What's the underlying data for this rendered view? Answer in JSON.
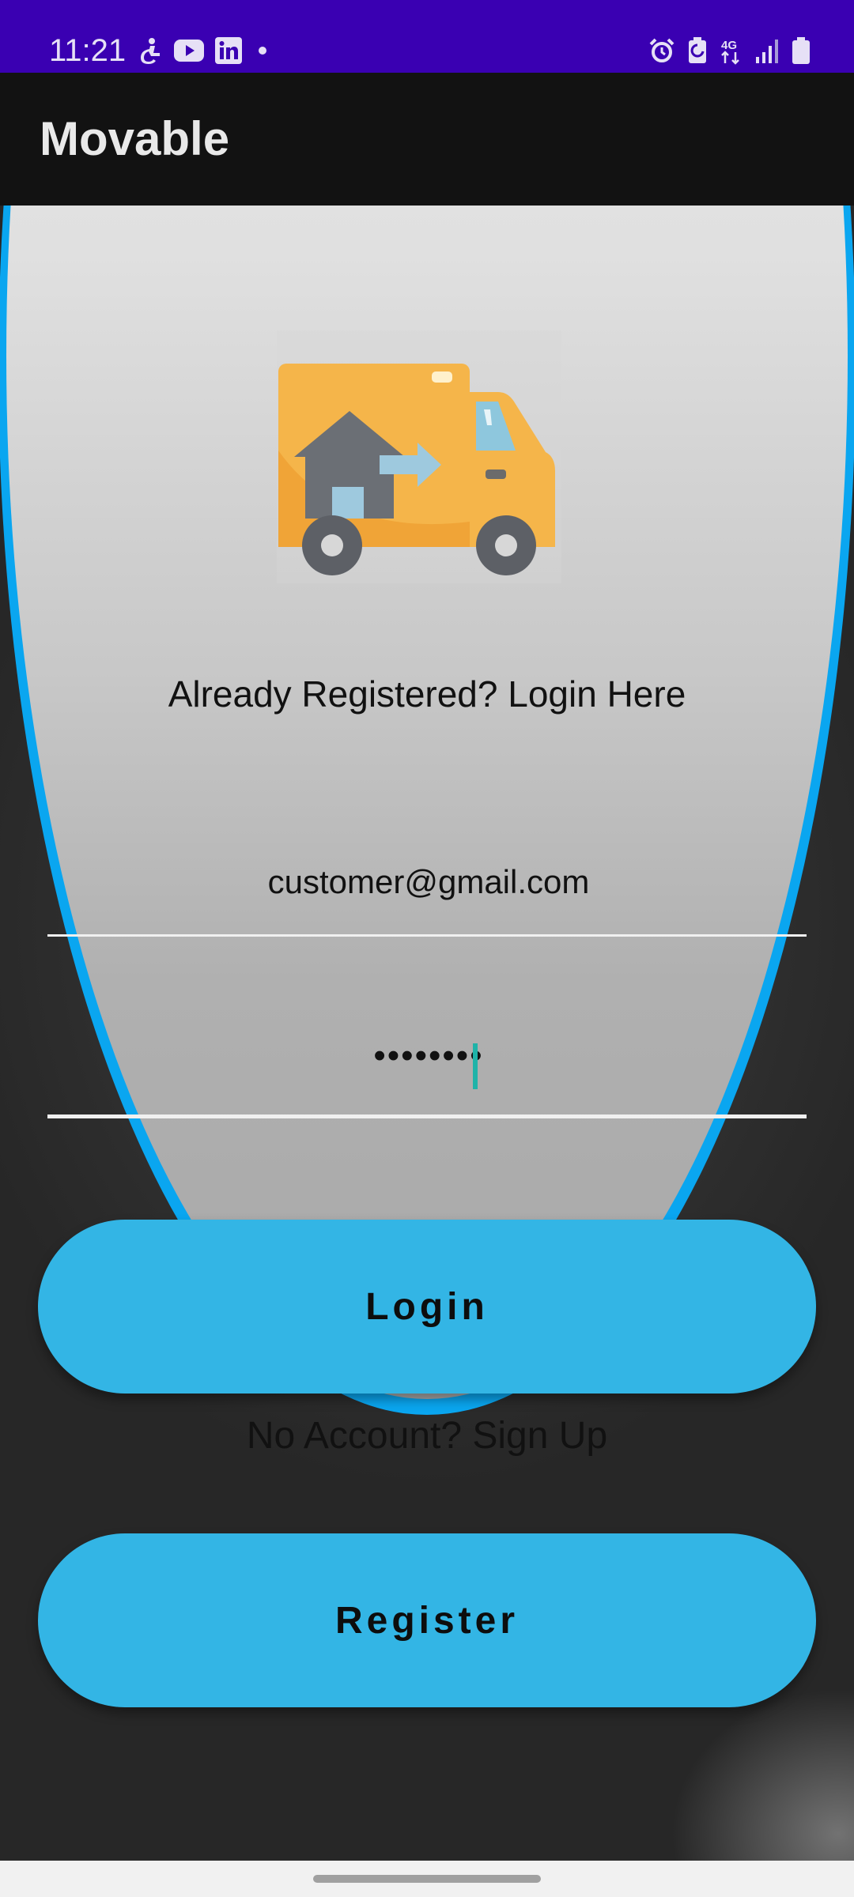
{
  "status_bar": {
    "time": "11:21",
    "left_icons": [
      "accessibility-icon",
      "youtube-icon",
      "linkedin-icon",
      "dot-icon"
    ],
    "right_icons": [
      "alarm-icon",
      "battery-saver-icon",
      "4g-data-icon",
      "signal-icon",
      "battery-icon"
    ],
    "network_label": "4G"
  },
  "app_bar": {
    "title": "Movable"
  },
  "main": {
    "logo_icon": "moving-truck-icon",
    "heading": "Already Registered? Login Here",
    "email": {
      "value": "customer@gmail.com"
    },
    "password": {
      "value": "••••••••"
    },
    "login_label": "Login",
    "signup_text": "No Account? Sign Up",
    "register_label": "Register"
  },
  "colors": {
    "status_bar": "#3a00b2",
    "app_bar": "#121212",
    "button": "#33b5e5",
    "oval_border": "#0aa6f0",
    "cursor": "#1fb3a8"
  }
}
